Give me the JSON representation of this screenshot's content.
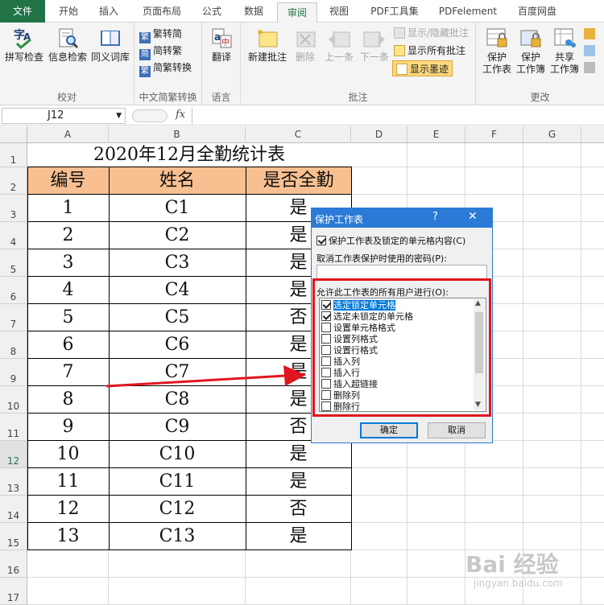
{
  "ribbon_tabs": [
    {
      "label": "文件"
    },
    {
      "label": "开始"
    },
    {
      "label": "插入"
    },
    {
      "label": "页面布局"
    },
    {
      "label": "公式"
    },
    {
      "label": "数据"
    },
    {
      "label": "审阅"
    },
    {
      "label": "视图"
    },
    {
      "label": "PDF工具集"
    },
    {
      "label": "PDFelement"
    },
    {
      "label": "百度网盘"
    }
  ],
  "ribbon": {
    "proofing": {
      "group": "校对",
      "spell": "拼写检查",
      "research": "信息检索",
      "thesaurus": "同义词库"
    },
    "chinese": {
      "group": "中文简繁转换",
      "to_simplified": "繁转简",
      "to_traditional": "简转繁",
      "convert": "简繁转换"
    },
    "language": {
      "group": "语言",
      "translate": "翻译"
    },
    "comments": {
      "group": "批注",
      "new": "新建批注",
      "delete": "删除",
      "prev": "上一条",
      "next": "下一条",
      "show_hide": "显示/隐藏批注",
      "show_all": "显示所有批注",
      "show_ink": "显示墨迹"
    },
    "changes": {
      "group": "更改",
      "protect_sheet": [
        "保护",
        "工作表"
      ],
      "protect_workbook": [
        "保护",
        "工作簿"
      ],
      "share_workbook": [
        "共享",
        "工作簿"
      ]
    }
  },
  "formula_bar": {
    "cell_ref": "J12",
    "fx": "fx",
    "value": ""
  },
  "columns": [
    "A",
    "B",
    "C",
    "D",
    "E",
    "F",
    "G"
  ],
  "rows": [
    "1",
    "2",
    "3",
    "4",
    "5",
    "6",
    "7",
    "8",
    "9",
    "10",
    "11",
    "12",
    "13",
    "14",
    "15",
    "16",
    "17"
  ],
  "sheet": {
    "title": "2020年12月全勤统计表",
    "headers": [
      "编号",
      "姓名",
      "是否全勤"
    ],
    "records": [
      [
        "1",
        "C1",
        "是"
      ],
      [
        "2",
        "C2",
        "是"
      ],
      [
        "3",
        "C3",
        "是"
      ],
      [
        "4",
        "C4",
        "是"
      ],
      [
        "5",
        "C5",
        "否"
      ],
      [
        "6",
        "C6",
        "是"
      ],
      [
        "7",
        "C7",
        "是"
      ],
      [
        "8",
        "C8",
        "是"
      ],
      [
        "9",
        "C9",
        "否"
      ],
      [
        "10",
        "C10",
        "是"
      ],
      [
        "11",
        "C11",
        "是"
      ],
      [
        "12",
        "C12",
        "否"
      ],
      [
        "13",
        "C13",
        "是"
      ]
    ]
  },
  "dialog": {
    "title": "保护工作表",
    "help": "?",
    "close": "✕",
    "protect_label": "保护工作表及锁定的单元格内容(C)",
    "password_label": "取消工作表保护时使用的密码(P):",
    "password_value": "",
    "allow_label": "允许此工作表的所有用户进行(O):",
    "options": [
      {
        "label": "选定锁定单元格",
        "checked": true
      },
      {
        "label": "选定未锁定的单元格",
        "checked": true
      },
      {
        "label": "设置单元格格式",
        "checked": false
      },
      {
        "label": "设置列格式",
        "checked": false
      },
      {
        "label": "设置行格式",
        "checked": false
      },
      {
        "label": "插入列",
        "checked": false
      },
      {
        "label": "插入行",
        "checked": false
      },
      {
        "label": "插入超链接",
        "checked": false
      },
      {
        "label": "删除列",
        "checked": false
      },
      {
        "label": "删除行",
        "checked": false
      }
    ],
    "ok": "确定",
    "cancel": "取消"
  },
  "watermark": {
    "brand": "Bai 经验",
    "url": "jingyan.baidu.com"
  },
  "colors": {
    "excel_green": "#217346",
    "header_fill": "#f8c090",
    "dialog_blue": "#2b7bd6",
    "highlight_red": "#e0161f"
  }
}
